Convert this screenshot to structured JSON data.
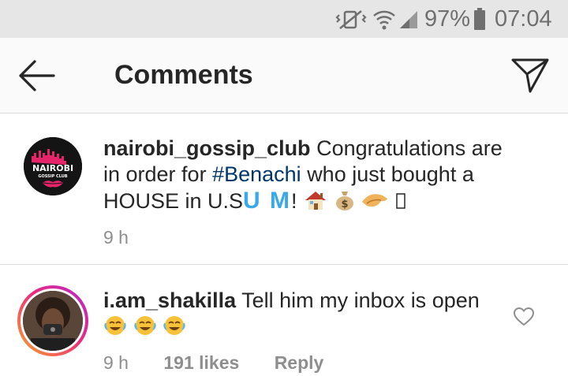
{
  "status_bar": {
    "battery_percent": "97%",
    "time": "07:04",
    "icons": [
      "mute-vibrate-icon",
      "wifi-icon",
      "signal-icon",
      "battery-icon"
    ]
  },
  "header": {
    "title": "Comments",
    "back_icon": "back-arrow-icon",
    "send_icon": "direct-send-icon"
  },
  "caption": {
    "avatar_text_main": "NAIROBI",
    "avatar_text_sub": "GOSSIP CLUB",
    "username": "nairobi_gossip_club",
    "text_part1": "Congratulations are in order for",
    "hashtag": "#Benachi",
    "text_part2": "who just bought a HOUSE in U.S",
    "text_um": "U M",
    "text_excl": "!",
    "emojis": [
      "house-emoji",
      "money-bag-emoji",
      "clapping-hands-emoji",
      "unknown-glyph"
    ],
    "time": "9 h"
  },
  "comment": {
    "username": "i.am_shakilla",
    "text": "Tell him my inbox is open",
    "emojis": [
      "crying-laughing-emoji",
      "crying-laughing-emoji",
      "crying-laughing-emoji"
    ],
    "time": "9 h",
    "likes": "191 likes",
    "reply_label": "Reply"
  },
  "colors": {
    "accent_hashtag": "#00376b",
    "um_blue": "#3aa9e8",
    "meta_gray": "#8e8e8e",
    "ring_gradient": [
      "#f9a52a",
      "#ee2a7b",
      "#b12ad1"
    ]
  }
}
